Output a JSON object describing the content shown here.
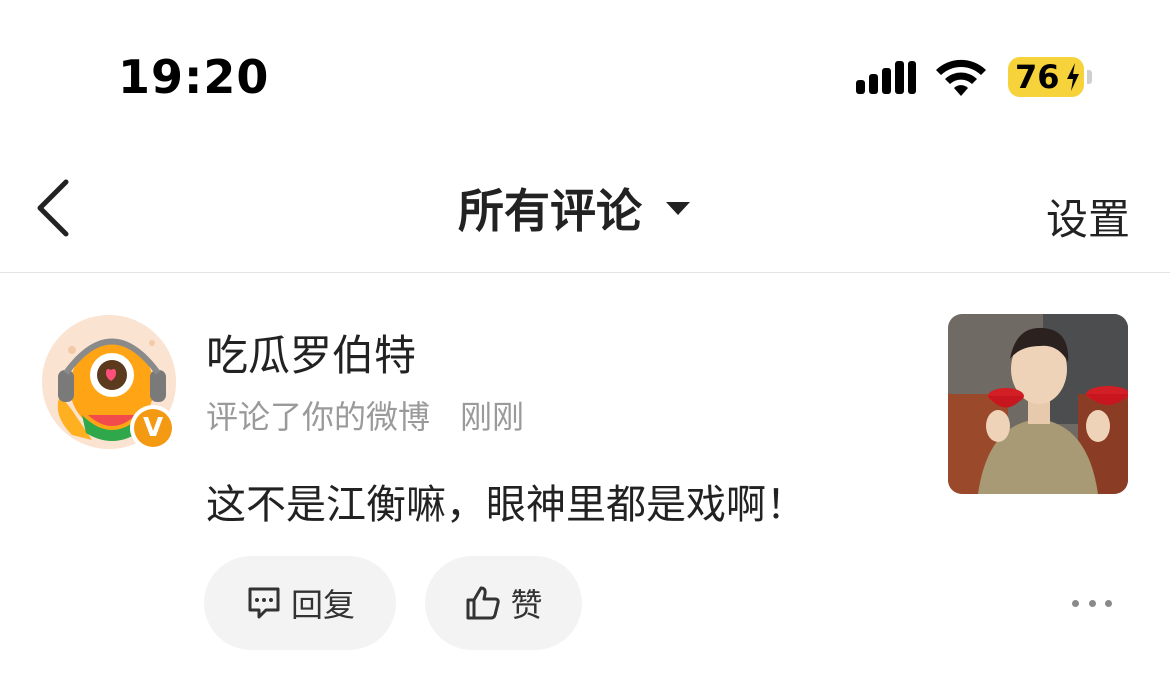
{
  "status_bar": {
    "time": "19:20",
    "battery": "76",
    "icons": [
      "cellular-signal-icon",
      "wifi-icon",
      "battery-charging-icon"
    ]
  },
  "nav": {
    "back_icon": "chevron-left-icon",
    "title": "所有评论",
    "title_icon": "caret-down-icon",
    "settings": "设置"
  },
  "comment": {
    "username": "吃瓜罗伯特",
    "action": "评论了你的微博",
    "time": "刚刚",
    "text": "这不是江衡嘛，眼神里都是戏啊！",
    "badge": "V",
    "badge_color": "#f39a12",
    "actions": {
      "reply": "回复",
      "like": "赞"
    },
    "more_icon": "more-dots-icon"
  },
  "colors": {
    "battery_fill": "#f6d33a",
    "action_bg": "#f3f3f3",
    "meta_text": "#9a9a9a"
  }
}
